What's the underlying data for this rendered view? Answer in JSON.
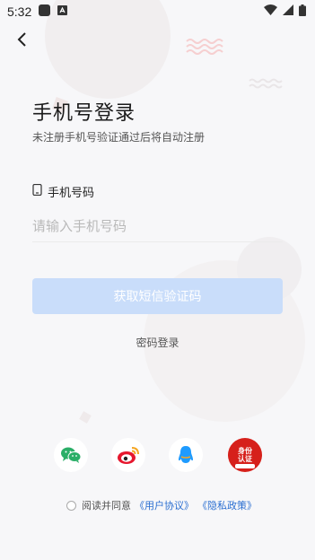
{
  "status_bar": {
    "time": "5:32"
  },
  "login": {
    "title": "手机号登录",
    "subtitle": "未注册手机号验证通过后将自动注册",
    "phone_label": "手机号码",
    "phone_placeholder": "请输入手机号码",
    "phone_value": "",
    "get_code_label": "获取短信验证码",
    "password_login_label": "密码登录"
  },
  "social_login": [
    {
      "icon": "wechat-icon",
      "color": "#2aae67"
    },
    {
      "icon": "weibo-icon",
      "color": "#e6162d"
    },
    {
      "icon": "qq-icon",
      "color": "#1e9bff"
    },
    {
      "icon": "identity-verification-icon",
      "color": "#d6201b",
      "logo_text": "身份认证"
    }
  ],
  "agreement": {
    "prefix": "阅读并同意",
    "user_agreement": "《用户协议》",
    "privacy_policy": "《隐私政策》",
    "checked": false
  },
  "colors": {
    "background": "#f7f7f9",
    "button_disabled": "#c9ddfa",
    "link": "#2b6fd1"
  }
}
